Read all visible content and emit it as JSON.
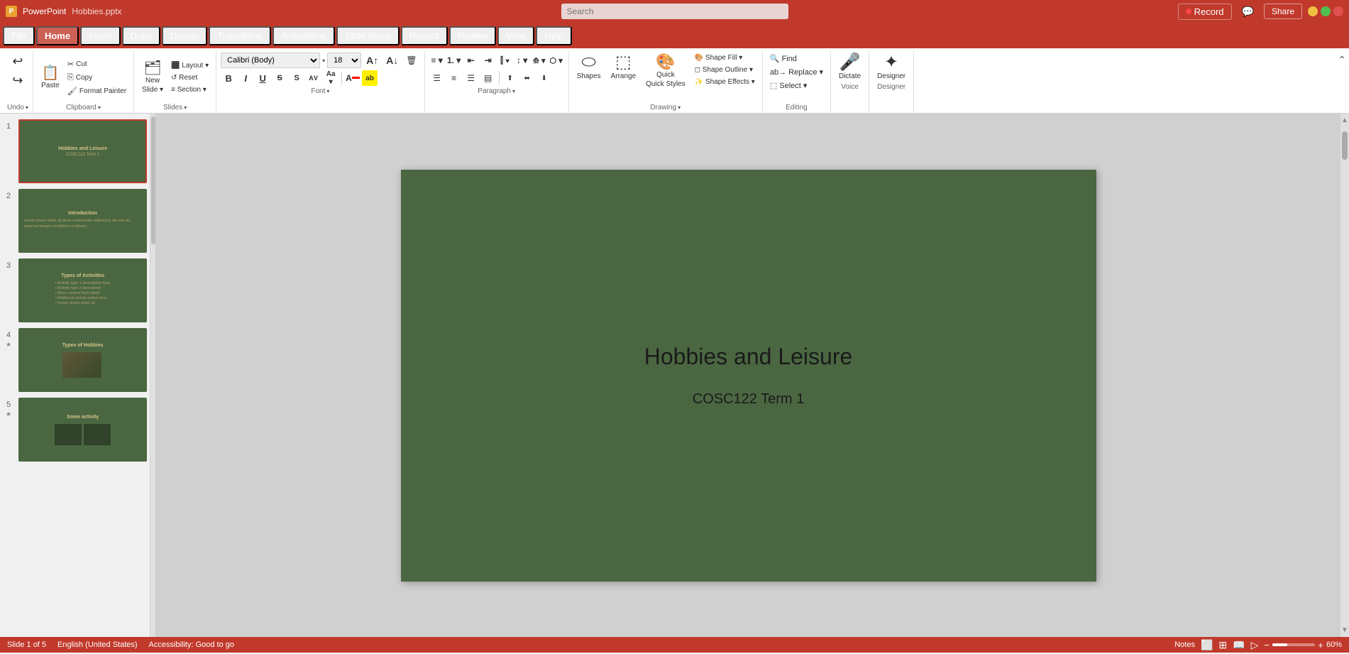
{
  "titlebar": {
    "search_placeholder": "Search",
    "record_label": "Record",
    "share_label": "Share",
    "comments_label": "Comments"
  },
  "menubar": {
    "items": [
      {
        "id": "file",
        "label": "File"
      },
      {
        "id": "home",
        "label": "Home",
        "active": true
      },
      {
        "id": "insert",
        "label": "Insert"
      },
      {
        "id": "draw",
        "label": "Draw"
      },
      {
        "id": "design",
        "label": "Design"
      },
      {
        "id": "transitions",
        "label": "Transitions"
      },
      {
        "id": "animations",
        "label": "Animations"
      },
      {
        "id": "slideshow",
        "label": "Slide Show"
      },
      {
        "id": "record",
        "label": "Record"
      },
      {
        "id": "review",
        "label": "Review"
      },
      {
        "id": "view",
        "label": "View"
      },
      {
        "id": "help",
        "label": "Help"
      }
    ]
  },
  "ribbon": {
    "groups": {
      "undo": {
        "label": "Undo",
        "undo_tip": "Undo",
        "redo_tip": "Redo"
      },
      "clipboard": {
        "label": "Clipboard",
        "paste_label": "Paste",
        "cut_label": "Cut",
        "copy_label": "Copy",
        "format_painter_label": "Format Painter"
      },
      "slides": {
        "label": "Slides",
        "new_slide_label": "New\nSlide",
        "layout_label": "Layout",
        "reset_label": "Reset",
        "section_label": "Section"
      },
      "font": {
        "label": "Font",
        "font_name": "Calibri (Body)",
        "font_size": "18",
        "bold": "B",
        "italic": "I",
        "underline": "U",
        "strikethrough": "S",
        "shadow": "S",
        "char_spacing": "AV",
        "font_color": "A",
        "highlight": "ab",
        "grow": "A↑",
        "shrink": "A↓",
        "clear": "Clear",
        "change_case": "Aa"
      },
      "paragraph": {
        "label": "Paragraph",
        "bullets": "Bullets",
        "numbering": "Numbering",
        "decrease_indent": "Decrease",
        "increase_indent": "Increase",
        "line_spacing": "Line",
        "align_left": "Left",
        "align_center": "Center",
        "align_right": "Right",
        "justify": "Justify",
        "columns": "Columns",
        "text_direction": "Direction",
        "smart_art": "SmartArt"
      },
      "drawing": {
        "label": "Drawing",
        "shapes_label": "Shapes",
        "arrange_label": "Arrange",
        "quick_styles_label": "Quick\nStyles",
        "shape_fill_label": "Shape Fill",
        "shape_outline_label": "Shape Outline"
      },
      "editing": {
        "label": "Editing",
        "find_label": "Find",
        "replace_label": "Replace",
        "select_label": "Select"
      },
      "voice": {
        "label": "Voice",
        "dictate_label": "Dictate"
      },
      "designer": {
        "label": "Designer",
        "designer_label": "Designer"
      }
    }
  },
  "slides": [
    {
      "num": "1",
      "active": true,
      "title": "Hobbies and Leisure",
      "subtitle": "COSC122 Term 1",
      "type": "title"
    },
    {
      "num": "2",
      "active": false,
      "title": "Introduction",
      "type": "content",
      "star": false
    },
    {
      "num": "3",
      "active": false,
      "title": "Types of Activities",
      "type": "content",
      "star": false
    },
    {
      "num": "4",
      "active": false,
      "title": "Types of Hobbies",
      "type": "image",
      "star": true
    },
    {
      "num": "5",
      "active": false,
      "title": "Some activity",
      "type": "image2",
      "star": true
    }
  ],
  "main_slide": {
    "title": "Hobbies and Leisure",
    "subtitle": "COSC122 Term 1",
    "background_color": "#4a6741"
  },
  "statusbar": {
    "slide_count": "Slide 1 of 5",
    "language": "English (United States)",
    "accessibility": "Accessibility: Good to go",
    "notes": "Notes",
    "view_normal": "Normal",
    "view_slide_sorter": "Slide Sorter",
    "view_reading": "Reading View",
    "view_slideshow": "Slide Show",
    "zoom": "60%"
  }
}
